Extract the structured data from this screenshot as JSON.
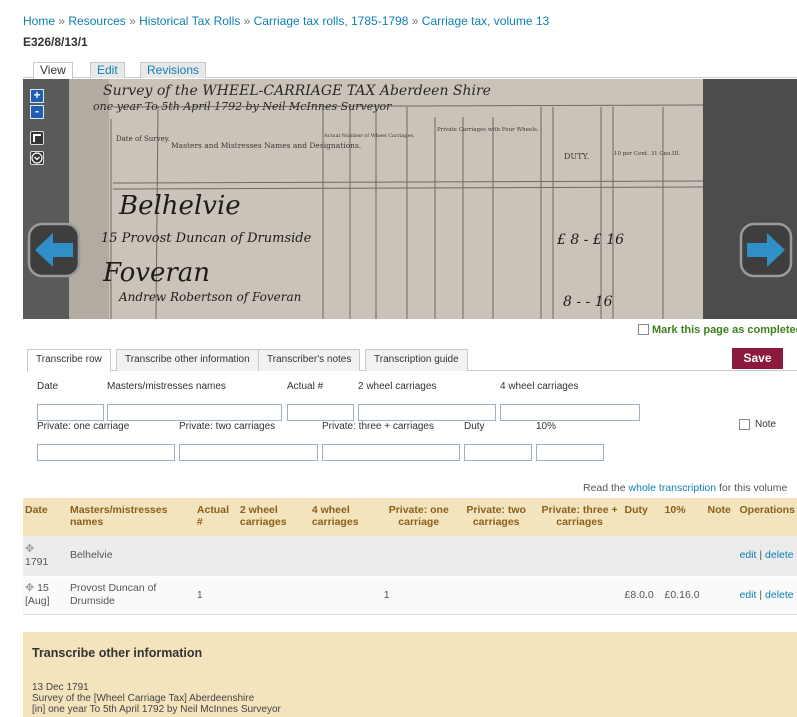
{
  "breadcrumb": {
    "items": [
      "Home",
      "Resources",
      "Historical Tax Rolls",
      "Carriage tax rolls, 1785-1798",
      "Carriage tax, volume 13"
    ],
    "separator": "»"
  },
  "page_title": "E326/8/13/1",
  "view_tabs": [
    "View",
    "Edit",
    "Revisions"
  ],
  "viewer": {
    "zoom_in": "+",
    "zoom_out": "-",
    "manuscript_lines": {
      "header": "Survey of the WHEEL-CARRIAGE TAX Aberdeen Shire",
      "header2": "one year To 5th April 1792 by Neil McInnes Surveyor",
      "col_date": "Date of Survey.",
      "col_names": "Masters and Mistresses Names and Designations.",
      "col_actual": "Actual Number of Wheel Carriages.",
      "col_private": "Private Carriages with Four Wheels.",
      "col_duty": "DUTY.",
      "col_10pct": "10 per Cent. 31 Geo.III.",
      "entry1": "Belhelvie",
      "entry2": "15 Provost Duncan of Drumside",
      "entry3": "Foveran",
      "entry4": "Andrew Robertson of Foveran",
      "amount1": "£ 8 - £ 16",
      "amount2": "8 - - 16"
    }
  },
  "mark_complete": "Mark this page as completed",
  "transcribe_tabs": [
    "Transcribe row",
    "Transcribe other information",
    "Transcriber's notes",
    "Transcription guide"
  ],
  "save_label": "Save",
  "form": {
    "labels_row1": [
      "Date",
      "Masters/mistresses names",
      "Actual #",
      "2 wheel carriages",
      "4 wheel carriages"
    ],
    "labels_row2": [
      "Private: one carriage",
      "Private: two carriages",
      "Private: three + carriages",
      "Duty",
      "10%"
    ],
    "note_label": "Note"
  },
  "read_whole": {
    "prefix": "Read the ",
    "link": "whole transcription",
    "suffix": " for this volume"
  },
  "table": {
    "headers": [
      "Date",
      "Masters/mistresses names",
      "Actual #",
      "2 wheel carriages",
      "4 wheel carriages",
      "Private: one carriage",
      "Private: two carriages",
      "Private: three + carriages",
      "Duty",
      "10%",
      "Note",
      "Operations"
    ],
    "rows": [
      {
        "date": "1791",
        "name": "Belhelvie",
        "actual": "",
        "two_wheel": "",
        "four_wheel": "",
        "p1": "",
        "p2": "",
        "p3": "",
        "duty": "",
        "ten": "",
        "note": "",
        "edit": "edit",
        "delete": "delete"
      },
      {
        "date": "15 [Aug]",
        "name": "Provost Duncan of Drumside",
        "actual": "1",
        "two_wheel": "",
        "four_wheel": "",
        "p1": "1",
        "p2": "",
        "p3": "",
        "duty": "£8.0.0",
        "ten": "£0.16.0",
        "note": "",
        "edit": "edit",
        "delete": "delete"
      }
    ],
    "ops_sep": "|"
  },
  "other_info": {
    "heading": "Transcribe other information",
    "lines": [
      "13 Dec 1791",
      "Survey of the [Wheel Carriage Tax] Aberdeenshire",
      "[in] one year To 5th April 1792 by Neil McInnes Surveyor"
    ]
  },
  "colors": {
    "link": "#0f7fb2",
    "save": "#8b1a3c",
    "table_header_bg": "#f3e4bd",
    "table_header_text": "#8a5f1b",
    "complete_green": "#3f7f1d"
  }
}
